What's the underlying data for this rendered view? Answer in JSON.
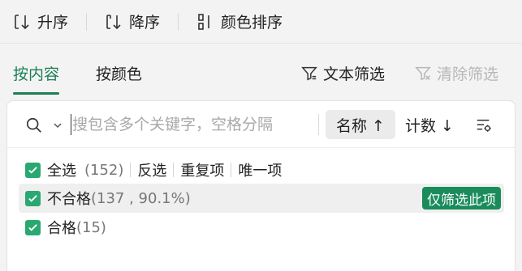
{
  "toolbar": {
    "sort_asc": "升序",
    "sort_desc": "降序",
    "color_sort": "颜色排序"
  },
  "tabs": {
    "by_content": "按内容",
    "by_color": "按颜色"
  },
  "actions": {
    "text_filter": "文本筛选",
    "clear_filter": "清除筛选"
  },
  "search": {
    "placeholder": "搜包含多个关键字，空格分隔",
    "value": ""
  },
  "sort": {
    "name_label": "名称 ↑",
    "count_label": "计数 ↓"
  },
  "list": {
    "select_all": "全选",
    "select_all_count": "(152)",
    "invert": "反选",
    "duplicates": "重复项",
    "unique": "唯一项",
    "items": [
      {
        "label": "不合格",
        "count": "(137 , 90.1%)",
        "checked": true
      },
      {
        "label": "合格",
        "count": "(15)",
        "checked": true
      }
    ],
    "only_filter_button": "仅筛选此项"
  },
  "colors": {
    "accent": "#1a7f54",
    "checkbox": "#2aa872",
    "only_button": "#1a8c5b"
  }
}
